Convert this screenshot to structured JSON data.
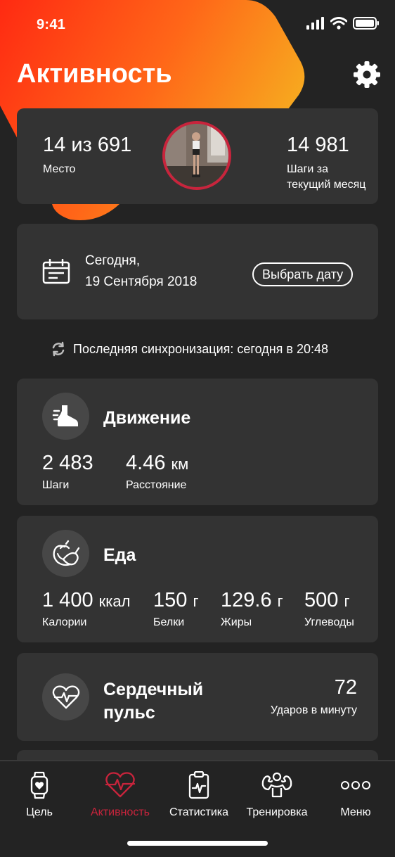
{
  "status_bar": {
    "time": "9:41"
  },
  "header": {
    "title": "Активность"
  },
  "rank_card": {
    "rank_value": "14 из 691",
    "rank_label": "Место",
    "steps_value": "14 981",
    "steps_label_1": "Шаги за",
    "steps_label_2": "текущий месяц"
  },
  "date_card": {
    "line1": "Сегодня,",
    "line2": "19 Сентября 2018",
    "pick_button": "Выбрать дату"
  },
  "sync": {
    "text": "Последняя синхронизация: сегодня в 20:48"
  },
  "movement_card": {
    "title": "Движение",
    "steps_value": "2 483",
    "steps_label": "Шаги",
    "distance_value": "4.46",
    "distance_unit": "км",
    "distance_label": "Расстояние"
  },
  "food_card": {
    "title": "Еда",
    "calories_value": "1 400",
    "calories_unit": "ккал",
    "calories_label": "Калории",
    "protein_value": "150",
    "protein_unit": "г",
    "protein_label": "Белки",
    "fat_value": "129.6",
    "fat_unit": "г",
    "fat_label": "Жиры",
    "carbs_value": "500",
    "carbs_unit": "г",
    "carbs_label": "Углеводы"
  },
  "heart_card": {
    "title_1": "Сердечный",
    "title_2": "пульс",
    "value": "72",
    "label": "Ударов в минуту"
  },
  "tabbar": {
    "items": [
      {
        "label": "Цель",
        "icon": "smartwatch-icon",
        "active": false
      },
      {
        "label": "Активность",
        "icon": "heart-pulse-icon",
        "active": true
      },
      {
        "label": "Статистика",
        "icon": "clipboard-chart-icon",
        "active": false
      },
      {
        "label": "Тренировка",
        "icon": "muscle-icon",
        "active": false
      },
      {
        "label": "Меню",
        "icon": "more-dots-icon",
        "active": false
      }
    ]
  },
  "colors": {
    "accent_red": "#c8243c",
    "gradient_start": "#ff2a12",
    "gradient_end": "#f7a81f",
    "background": "#232323",
    "card": "#333333"
  }
}
